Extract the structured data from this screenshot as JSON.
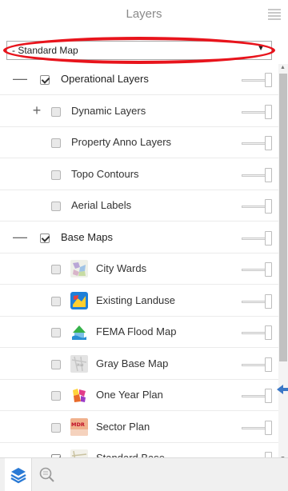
{
  "header": {
    "title": "Layers",
    "menu_icon": "hamburger-menu-icon"
  },
  "basemap_select": {
    "value": "- Standard Map",
    "arrow": "▼"
  },
  "layers": [
    {
      "label": "Operational Layers",
      "checked": true,
      "expander": "—",
      "level": 0
    },
    {
      "label": "Dynamic Layers",
      "checked": false,
      "expander": "+",
      "level": 1
    },
    {
      "label": "Property Anno Layers",
      "checked": false,
      "expander": "",
      "level": 1
    },
    {
      "label": "Topo Contours",
      "checked": false,
      "expander": "",
      "level": 1
    },
    {
      "label": "Aerial Labels",
      "checked": false,
      "expander": "",
      "level": 1
    },
    {
      "label": "Base Maps",
      "checked": true,
      "expander": "—",
      "level": 0
    },
    {
      "label": "City Wards",
      "checked": false,
      "expander": "",
      "level": 1,
      "thumbnail": "city-wards-thumbnail"
    },
    {
      "label": "Existing Landuse",
      "checked": false,
      "expander": "",
      "level": 1,
      "thumbnail": "existing-landuse-thumbnail"
    },
    {
      "label": "FEMA Flood Map",
      "checked": false,
      "expander": "",
      "level": 1,
      "thumbnail": "fema-flood-thumbnail"
    },
    {
      "label": "Gray Base Map",
      "checked": false,
      "expander": "",
      "level": 1,
      "thumbnail": "gray-base-thumbnail"
    },
    {
      "label": "One Year Plan",
      "checked": false,
      "expander": "",
      "level": 1,
      "thumbnail": "one-year-plan-thumbnail"
    },
    {
      "label": "Sector Plan",
      "checked": false,
      "expander": "",
      "level": 1,
      "thumbnail": "sector-plan-thumbnail",
      "thumb_text": "MDR"
    },
    {
      "label": "Standard Base",
      "checked": true,
      "expander": "",
      "level": 1,
      "thumbnail": "standard-base-thumbnail"
    }
  ],
  "footer": {
    "tabs": [
      "layers-stack-icon",
      "legend-search-icon"
    ]
  },
  "colors": {
    "highlight": "#e8141c",
    "accent_blue": "#2a7ad5",
    "callout_arrow": "#3b78c7"
  }
}
